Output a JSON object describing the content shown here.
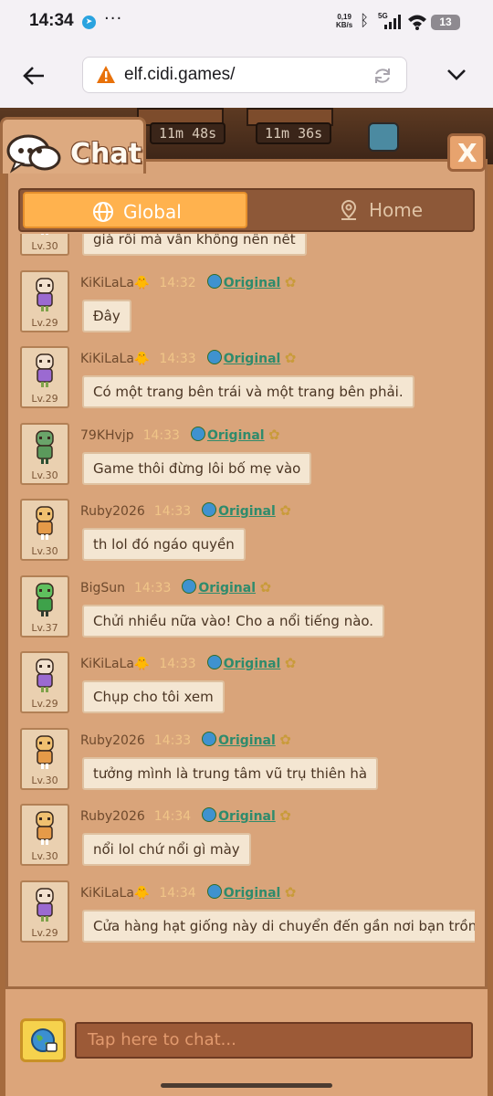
{
  "status_bar": {
    "time": "14:34",
    "speed_value": "0,19",
    "speed_unit": "KB/s",
    "network": "5G",
    "battery": "13"
  },
  "browser": {
    "url": "elf.cidi.games/"
  },
  "game_hud": {
    "timer_1": "11m 48s",
    "timer_2": "11m 36s"
  },
  "chat": {
    "title": "Chat",
    "close_label": "X",
    "tabs": [
      {
        "label": "Global",
        "active": true
      },
      {
        "label": "Home",
        "active": false
      }
    ],
    "messages": [
      {
        "name": "",
        "time": "",
        "level": "Lv.30",
        "avatar": "fox",
        "text": "già rồi mà vẫn không nên nết",
        "original": "Original"
      },
      {
        "name": "KiKiLaLa🐥",
        "time": "14:32",
        "level": "Lv.29",
        "avatar": "purple",
        "text": "Đây",
        "original": "Original"
      },
      {
        "name": "KiKiLaLa🐥",
        "time": "14:33",
        "level": "Lv.29",
        "avatar": "purple",
        "text": "Có một trang bên trái và một trang bên phải.",
        "original": "Original"
      },
      {
        "name": "79KHvjp",
        "time": "14:33",
        "level": "Lv.30",
        "avatar": "green",
        "text": "Game thôi đừng lôi bố mẹ vào",
        "original": "Original"
      },
      {
        "name": "Ruby2026",
        "time": "14:33",
        "level": "Lv.30",
        "avatar": "fox",
        "text": "th lol đó ngáo quyền",
        "original": "Original"
      },
      {
        "name": "BigSun",
        "time": "14:33",
        "level": "Lv.37",
        "avatar": "frog",
        "text": "Chửi nhiều nữa vào! Cho a nổi tiếng nào.",
        "original": "Original"
      },
      {
        "name": "KiKiLaLa🐥",
        "time": "14:33",
        "level": "Lv.29",
        "avatar": "purple",
        "text": "Chụp cho tôi xem",
        "original": "Original"
      },
      {
        "name": "Ruby2026",
        "time": "14:33",
        "level": "Lv.30",
        "avatar": "fox",
        "text": "tưởng mình là trung tâm vũ trụ thiên hà",
        "original": "Original"
      },
      {
        "name": "Ruby2026",
        "time": "14:34",
        "level": "Lv.30",
        "avatar": "fox",
        "text": "nổi lol chứ nổi gì mày",
        "original": "Original"
      },
      {
        "name": "KiKiLaLa🐥",
        "time": "14:34",
        "level": "Lv.29",
        "avatar": "purple",
        "text": "Cửa hàng hạt giống này di chuyển đến gần nơi bạn trồng cây.",
        "original": "Original"
      }
    ],
    "input_placeholder": "Tap here to chat..."
  },
  "colors": {
    "panel": "#d9a47a",
    "tab_active": "#ffb24e",
    "bubble": "#f4e6d2",
    "link": "#2f8b6c"
  }
}
